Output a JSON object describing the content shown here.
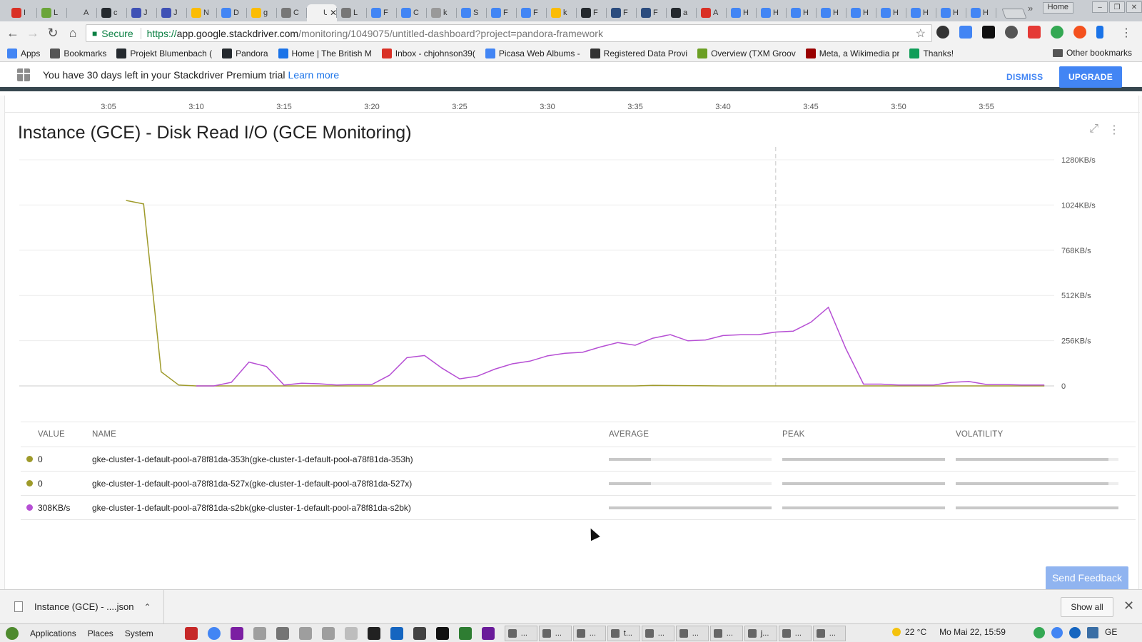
{
  "browser": {
    "tabs": [
      {
        "label": "I",
        "color": "#d93025"
      },
      {
        "label": "L",
        "color": "#6ba539"
      },
      {
        "label": "A",
        "color": "#c9cdd2"
      },
      {
        "label": "c",
        "color": "#24292e"
      },
      {
        "label": "J",
        "color": "#3f51b5"
      },
      {
        "label": "J",
        "color": "#3f51b5"
      },
      {
        "label": "N",
        "color": "#fbbc05"
      },
      {
        "label": "D",
        "color": "#4285f4"
      },
      {
        "label": "g",
        "color": "#fbbc05"
      },
      {
        "label": "C",
        "color": "#777777"
      },
      {
        "label": "U",
        "color": "#f2f2f2",
        "active": true
      },
      {
        "label": "L",
        "color": "#777777"
      },
      {
        "label": "F",
        "color": "#4285f4"
      },
      {
        "label": "C",
        "color": "#4285f4"
      },
      {
        "label": "k",
        "color": "#999999"
      },
      {
        "label": "S",
        "color": "#4285f4"
      },
      {
        "label": "F",
        "color": "#4285f4"
      },
      {
        "label": "F",
        "color": "#4285f4"
      },
      {
        "label": "k",
        "color": "#fbbc05"
      },
      {
        "label": "F",
        "color": "#24292e"
      },
      {
        "label": "F",
        "color": "#2b4c7e"
      },
      {
        "label": "F",
        "color": "#2b4c7e"
      },
      {
        "label": "a",
        "color": "#24292e"
      },
      {
        "label": "A",
        "color": "#d93025"
      },
      {
        "label": "H",
        "color": "#4285f4"
      },
      {
        "label": "H",
        "color": "#4285f4"
      },
      {
        "label": "H",
        "color": "#4285f4"
      },
      {
        "label": "H",
        "color": "#4285f4"
      },
      {
        "label": "H",
        "color": "#4285f4"
      },
      {
        "label": "H",
        "color": "#4285f4"
      },
      {
        "label": "H",
        "color": "#4285f4"
      },
      {
        "label": "H",
        "color": "#4285f4"
      },
      {
        "label": "H",
        "color": "#4285f4"
      }
    ],
    "home_button": "Home",
    "window_buttons": [
      "–",
      "❐",
      "✕"
    ],
    "omnibox": {
      "secure_label": "Secure",
      "url_scheme": "https://",
      "url_host": "app.google.stackdriver.com",
      "url_path": "/monitoring/1049075/untitled-dashboard?project=pandora-framework"
    },
    "bookmarks": [
      {
        "label": "Apps",
        "icon": "apps-grid-icon",
        "color": "#4285f4"
      },
      {
        "label": "Bookmarks",
        "icon": "star-icon",
        "color": "#555555"
      },
      {
        "label": "Projekt Blumenbach (",
        "icon": "github-icon",
        "color": "#24292e"
      },
      {
        "label": "Pandora",
        "icon": "github-icon",
        "color": "#24292e"
      },
      {
        "label": "Home | The British M",
        "icon": "bl-icon",
        "color": "#1a73e8"
      },
      {
        "label": "Inbox - chjohnson39(",
        "icon": "gmail-icon",
        "color": "#d93025"
      },
      {
        "label": "Picasa Web Albums -",
        "icon": "google-icon",
        "color": "#4285f4"
      },
      {
        "label": "Registered Data Provi",
        "icon": "registry-icon",
        "color": "#333333"
      },
      {
        "label": "Overview (TXM Groov",
        "icon": "groovy-icon",
        "color": "#6b9f23"
      },
      {
        "label": "Meta, a Wikimedia pr",
        "icon": "wikimedia-icon",
        "color": "#990000"
      },
      {
        "label": "Thanks!",
        "icon": "sheets-icon",
        "color": "#0f9d58"
      }
    ],
    "bookmarks_more": "»",
    "other_bookmarks": "Other bookmarks"
  },
  "banner": {
    "message": "You have 30 days left in your Stackdriver Premium trial",
    "link": "Learn more",
    "dismiss": "DISMISS",
    "upgrade": "UPGRADE"
  },
  "time_axis": [
    "3:05",
    "3:10",
    "3:15",
    "3:20",
    "3:25",
    "3:30",
    "3:35",
    "3:40",
    "3:45",
    "3:50",
    "3:55"
  ],
  "chart": {
    "title": "Instance (GCE) - Disk Read I/O (GCE Monitoring)",
    "y_tick_labels": [
      "1280KB/s",
      "1024KB/s",
      "768KB/s",
      "512KB/s",
      "256KB/s",
      "0"
    ]
  },
  "chart_data": {
    "type": "line",
    "title": "Instance (GCE) - Disk Read I/O (GCE Monitoring)",
    "xlabel": "",
    "ylabel": "",
    "x_unit": "clock time (minutes after 3:00)",
    "y_unit": "KB/s",
    "ylim": [
      0,
      1280
    ],
    "y_ticks": [
      0,
      256,
      512,
      768,
      1024,
      1280
    ],
    "grid": true,
    "cursor_x": 3.43,
    "series": [
      {
        "color": "#9e9a2a",
        "x": [
          3.06,
          3.07,
          3.08,
          3.09,
          3.1,
          3.11,
          3.15,
          3.2,
          3.25,
          3.3,
          3.35,
          3.36,
          3.4,
          3.45,
          3.5,
          3.55,
          3.583
        ],
        "y": [
          1050,
          1030,
          80,
          5,
          0,
          0,
          0,
          0,
          0,
          0,
          0,
          3,
          0,
          0,
          0,
          0,
          0
        ]
      },
      {
        "color": "#b64fd4",
        "x": [
          3.1,
          3.11,
          3.12,
          3.13,
          3.14,
          3.15,
          3.16,
          3.17,
          3.18,
          3.19,
          3.2,
          3.21,
          3.22,
          3.23,
          3.24,
          3.25,
          3.26,
          3.27,
          3.28,
          3.29,
          3.3,
          3.31,
          3.32,
          3.33,
          3.34,
          3.35,
          3.36,
          3.37,
          3.38,
          3.39,
          3.4,
          3.41,
          3.42,
          3.43,
          3.44,
          3.45,
          3.46,
          3.47,
          3.48,
          3.49,
          3.5,
          3.51,
          3.52,
          3.53,
          3.54,
          3.55,
          3.56,
          3.57,
          3.583
        ],
        "y": [
          0,
          0,
          20,
          135,
          110,
          5,
          15,
          12,
          5,
          8,
          8,
          60,
          160,
          172,
          100,
          40,
          55,
          95,
          125,
          140,
          170,
          185,
          190,
          220,
          245,
          230,
          270,
          290,
          255,
          260,
          285,
          290,
          290,
          305,
          310,
          360,
          445,
          210,
          10,
          10,
          5,
          5,
          5,
          20,
          25,
          8,
          8,
          5,
          5
        ]
      }
    ]
  },
  "legend": {
    "headers": {
      "value": "VALUE",
      "name": "NAME",
      "average": "AVERAGE",
      "peak": "PEAK",
      "volatility": "VOLATILITY"
    },
    "rows": [
      {
        "color": "#9e9a2a",
        "value": "0",
        "name": "gke-cluster-1-default-pool-a78f81da-353h(gke-cluster-1-default-pool-a78f81da-353h)",
        "average": 0.26,
        "peak": 1.0,
        "volatility": 0.94
      },
      {
        "color": "#9e9a2a",
        "value": "0",
        "name": "gke-cluster-1-default-pool-a78f81da-527x(gke-cluster-1-default-pool-a78f81da-527x)",
        "average": 0.26,
        "peak": 1.0,
        "volatility": 0.94
      },
      {
        "color": "#b64fd4",
        "value": "308KB/s",
        "name": "gke-cluster-1-default-pool-a78f81da-s2bk(gke-cluster-1-default-pool-a78f81da-s2bk)",
        "average": 1.0,
        "peak": 1.0,
        "volatility": 1.0
      }
    ]
  },
  "send_feedback": "Send Feedback",
  "downloads": {
    "file_name": "Instance (GCE) - ....json",
    "show_all": "Show all",
    "close": "✕"
  },
  "taskbar": {
    "menus": [
      "Applications",
      "Places",
      "System"
    ],
    "windows": [
      "...",
      "...",
      "...",
      "t...",
      "...",
      "...",
      "...",
      "j...",
      "...",
      "..."
    ],
    "weather": "22 °C",
    "clock": "Mo Mai 22, 15:59",
    "keyboard_layout": "GE"
  }
}
